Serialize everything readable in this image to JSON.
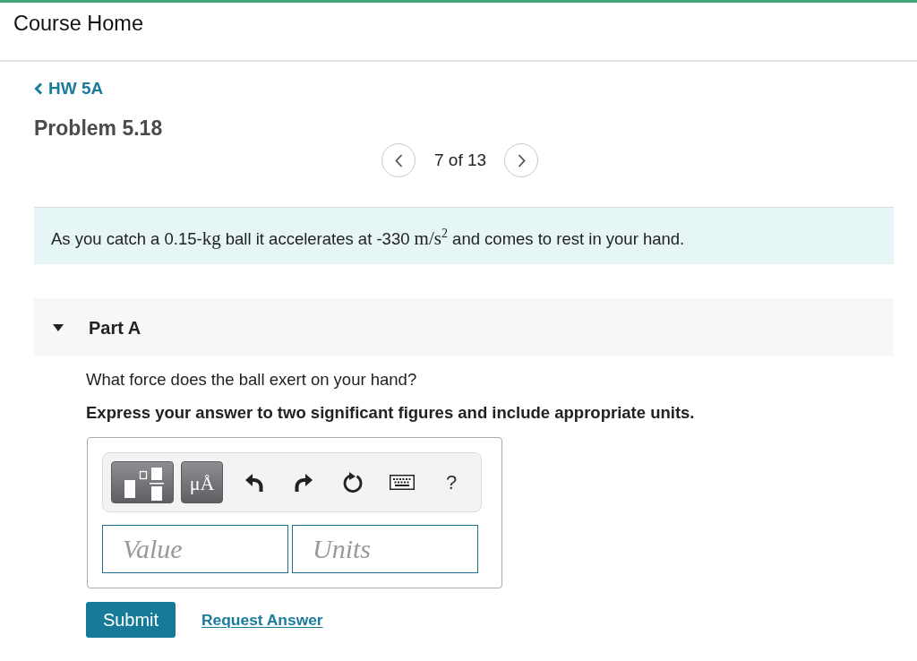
{
  "header": {
    "title": "Course Home"
  },
  "breadcrumb": {
    "label": "HW 5A"
  },
  "problem": {
    "title": "Problem 5.18"
  },
  "pager": {
    "position": "7 of 13"
  },
  "statement": {
    "parts": [
      {
        "kind": "text",
        "text": "As you catch a 0.15-"
      },
      {
        "kind": "math",
        "text": "kg"
      },
      {
        "kind": "text",
        "text": " ball it accelerates at -330 "
      },
      {
        "kind": "math",
        "text": "m/s$^{2}$"
      },
      {
        "kind": "text",
        "text": " and comes to rest in your hand."
      }
    ]
  },
  "part": {
    "title": "Part A",
    "expanded": true,
    "question": "What force does the ball exert on your hand?",
    "instruction": "Express your answer to two significant figures and include appropriate units.",
    "toolbar": [
      {
        "kind": "templates"
      },
      {
        "kind": "units",
        "label": "μÅ"
      },
      {
        "kind": "undo"
      },
      {
        "kind": "redo"
      },
      {
        "kind": "reset"
      },
      {
        "kind": "keyboard"
      },
      {
        "kind": "help",
        "label": "?"
      }
    ],
    "fields": [
      {
        "placeholder": "Value"
      },
      {
        "placeholder": "Units"
      }
    ],
    "submit": "Submit",
    "request": "Request Answer"
  }
}
